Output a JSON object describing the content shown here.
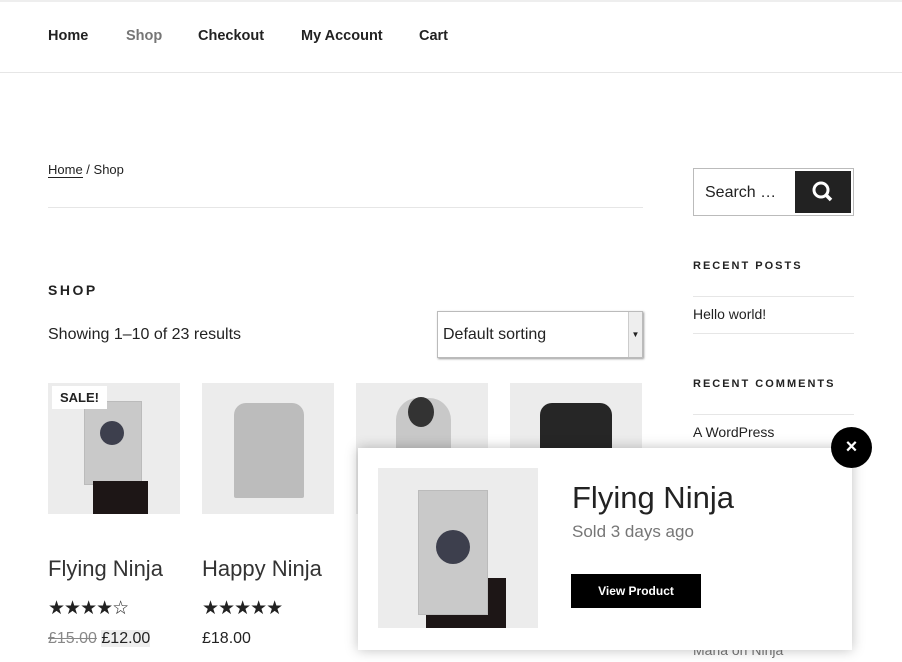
{
  "nav": {
    "items": [
      "Home",
      "Shop",
      "Checkout",
      "My Account",
      "Cart"
    ],
    "active": "Shop"
  },
  "breadcrumb": {
    "home": "Home",
    "sep": " / ",
    "current": "Shop"
  },
  "page_title": "SHOP",
  "result_count": "Showing 1–10 of 23 results",
  "sorting": {
    "selected": "Default sorting"
  },
  "products": [
    {
      "title": "Flying Ninja",
      "rating": 4,
      "stars": "★★★★☆",
      "old_price": "£15.00",
      "price": "£12.00",
      "badge": "SALE!"
    },
    {
      "title": "Happy Ninja",
      "rating": 5,
      "stars": "★★★★★",
      "price": "£18.00"
    }
  ],
  "sidebar": {
    "search_placeholder": "Search …",
    "recent_posts_title": "RECENT POSTS",
    "posts": [
      "Hello world!"
    ],
    "recent_comments_title": "RECENT COMMENTS",
    "comments": [
      "A WordPress",
      "Maria on Ninja"
    ]
  },
  "popup": {
    "title": "Flying Ninja",
    "subtitle": "Sold 3 days ago",
    "button": "View Product",
    "close": "×"
  },
  "colors": {
    "accent": "#222222",
    "muted": "#767676"
  }
}
